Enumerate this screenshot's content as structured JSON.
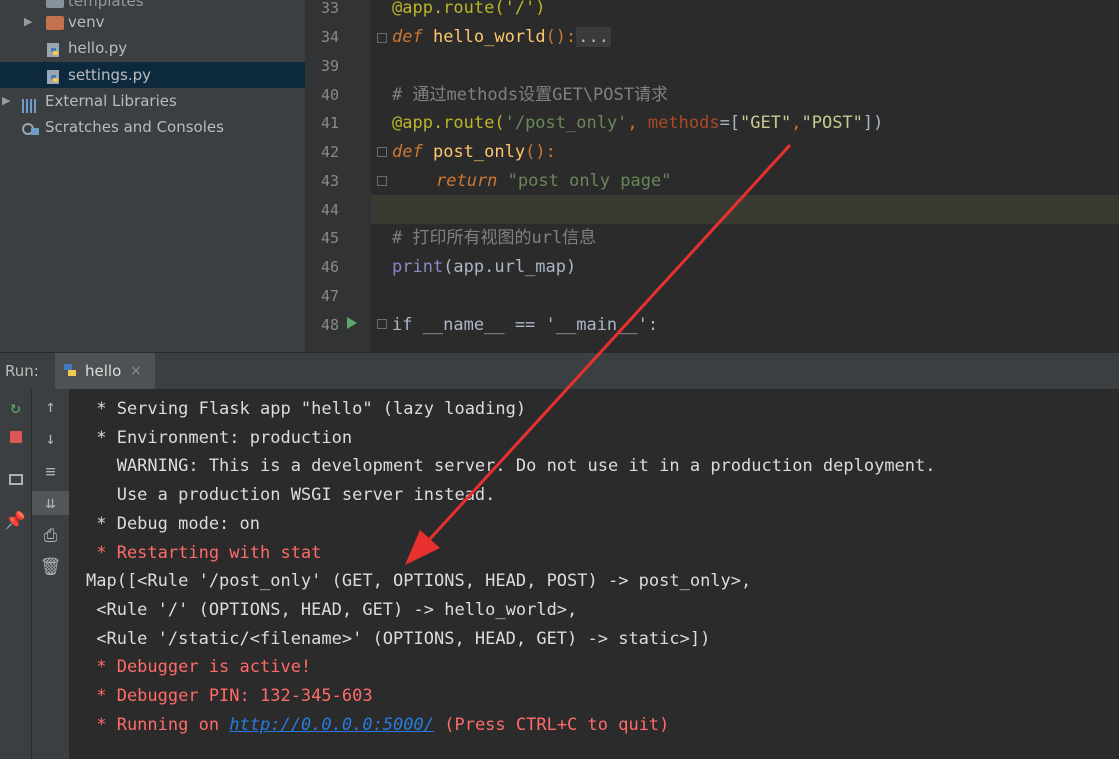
{
  "project_tree": {
    "items": [
      {
        "label": "templates"
      },
      {
        "label": "venv"
      },
      {
        "label": "hello.py"
      },
      {
        "label": "settings.py"
      },
      {
        "label": "External Libraries"
      },
      {
        "label": "Scratches and Consoles"
      }
    ]
  },
  "editor": {
    "line_numbers": [
      "33",
      "34",
      "39",
      "40",
      "41",
      "42",
      "43",
      "44",
      "45",
      "46",
      "47",
      "48"
    ],
    "code": {
      "l33": "@app.route('/')",
      "l34_def": "def",
      "l34_fn": "hello_world",
      "l34_rest": "():",
      "l34_fold": "...",
      "l40": "# 通过methods设置GET\\POST请求",
      "l41_dec": "@app.route(",
      "l41_str": "'/post_only'",
      "l41_sep": ", ",
      "l41_kwarg": "methods",
      "l41_eq": "=[",
      "l41_get": "\"GET\"",
      "l41_comma": ",",
      "l41_post": "\"POST\"",
      "l41_end": "])",
      "l42_def": "def",
      "l42_fn": "post_only",
      "l42_rest": "():",
      "l43_return": "return",
      "l43_str": "\"post only page\"",
      "l45": "# 打印所有视图的url信息",
      "l46_print": "print",
      "l46_rest": "(app.url_map)",
      "l48": "if __name__ == '__main__':"
    }
  },
  "run": {
    "label": "Run:",
    "tab_label": "hello",
    "close_glyph": "×"
  },
  "console": {
    "lines": [
      " * Serving Flask app \"hello\" (lazy loading)",
      " * Environment: production",
      "   WARNING: This is a development server. Do not use it in a production deployment.",
      "   Use a production WSGI server instead.",
      " * Debug mode: on",
      " * Restarting with stat",
      "Map([<Rule '/post_only' (GET, OPTIONS, HEAD, POST) -> post_only>,",
      " <Rule '/' (OPTIONS, HEAD, GET) -> hello_world>,",
      " <Rule '/static/<filename>' (OPTIONS, HEAD, GET) -> static>])",
      " * Debugger is active!",
      " * Debugger PIN: 132-345-603"
    ],
    "running_prefix": " * Running on ",
    "running_url": "http://0.0.0.0:5000/",
    "running_suffix": " (Press CTRL+C to quit)"
  },
  "colors": {
    "console_error": "#ff6b68",
    "annotation_arrow": "#e8312f",
    "link": "#287bde"
  },
  "icons": [
    "folder-icon",
    "python-file-icon",
    "library-icon",
    "scratches-icon",
    "rerun-icon",
    "stop-icon",
    "layout-icon",
    "pin-icon",
    "up-arrow-icon",
    "down-arrow-icon",
    "soft-wrap-icon",
    "scroll-to-end-icon",
    "print-icon",
    "trash-icon",
    "run-gutter-icon"
  ]
}
